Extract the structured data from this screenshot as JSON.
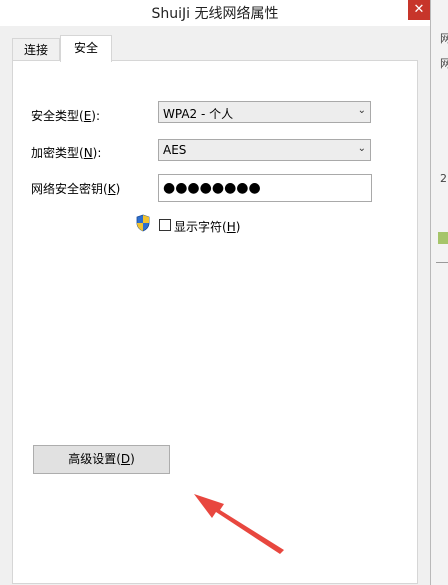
{
  "window": {
    "title": "ShuiJi 无线网络属性",
    "close_glyph": "✕"
  },
  "tabs": [
    {
      "label": "连接",
      "selected": false
    },
    {
      "label": "安全",
      "selected": true
    }
  ],
  "security_type": {
    "label_prefix": "安全类型(",
    "label_key": "E",
    "label_suffix": "):",
    "value": "WPA2 - 个人"
  },
  "encryption_type": {
    "label_prefix": "加密类型(",
    "label_key": "N",
    "label_suffix": "):",
    "value": "AES"
  },
  "network_key": {
    "label_prefix": "网络安全密钥(",
    "label_key": "K",
    "label_suffix": ")",
    "value": "●●●●●●●●"
  },
  "show_chars": {
    "label_prefix": "显示字符(",
    "label_key": "H",
    "label_suffix": ")",
    "checked": false
  },
  "advanced_button": {
    "label_prefix": "高级设置(",
    "label_key": "D",
    "label_suffix": ")"
  },
  "dropdown_chevron": "⌄",
  "background_window_chars": [
    "网",
    "网",
    "2"
  ],
  "colors": {
    "close": "#c7352a",
    "arrow": "#e8473f",
    "panel": "#ffffff",
    "dialog": "#f0f0f0"
  }
}
